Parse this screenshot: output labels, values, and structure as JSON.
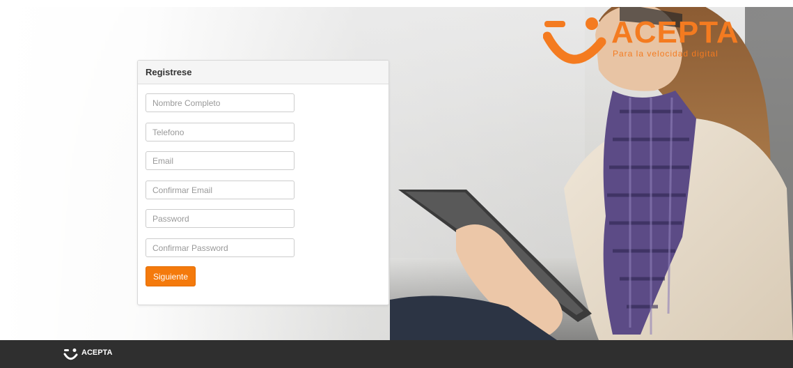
{
  "brand": {
    "name": "ACEPTA",
    "tagline": "Para la velocidad digital",
    "accent_color": "#f47b20"
  },
  "form": {
    "title": "Registrese",
    "fields": {
      "full_name": "Nombre Completo",
      "phone": "Telefono",
      "email": "Email",
      "confirm_email": "Confirmar Email",
      "password": "Password",
      "confirm_password": "Confirmar Password"
    },
    "submit_label": "Siguiente",
    "button_color": "#f47a0c"
  },
  "footer": {
    "brand": "ACEPTA",
    "background": "#2f2f2f"
  }
}
